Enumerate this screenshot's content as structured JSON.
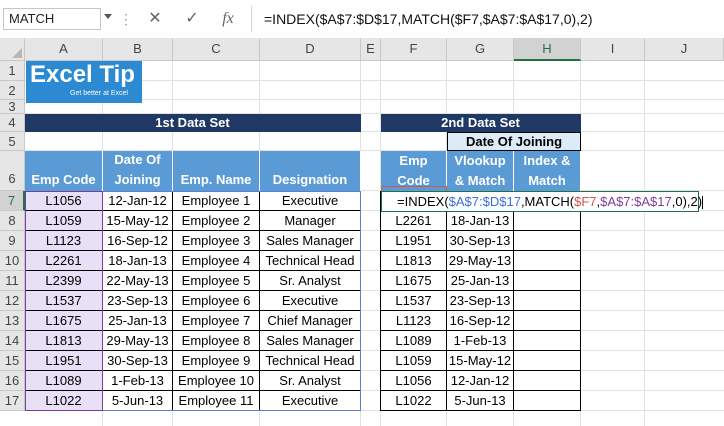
{
  "name_box": "MATCH",
  "formula": "=INDEX($A$7:$D$17,MATCH($F7,$A$7:$A$17,0),2)",
  "formula_buttons": {
    "cancel_glyph": "✕",
    "enter_glyph": "✓",
    "fx_glyph": "fx"
  },
  "columns": [
    "A",
    "B",
    "C",
    "D",
    "E",
    "F",
    "G",
    "H",
    "I",
    "J"
  ],
  "rows": [
    "1",
    "2",
    "3",
    "4",
    "5",
    "6",
    "7",
    "8",
    "9",
    "10",
    "11",
    "12",
    "13",
    "14",
    "15",
    "16",
    "17"
  ],
  "logo": {
    "main": "Excel Tip",
    "tagline": "Get better at Excel"
  },
  "set1": {
    "title": "1st Data Set",
    "headers": [
      "Emp Code",
      "Date Of Joining",
      "Emp. Name",
      "Designation"
    ],
    "rows": [
      [
        "L1056",
        "12-Jan-12",
        "Employee 1",
        "Executive"
      ],
      [
        "L1059",
        "15-May-12",
        "Employee 2",
        "Manager"
      ],
      [
        "L1123",
        "16-Sep-12",
        "Employee 3",
        "Sales Manager"
      ],
      [
        "L2261",
        "18-Jan-13",
        "Employee 4",
        "Technical Head"
      ],
      [
        "L2399",
        "22-May-13",
        "Employee 5",
        "Sr. Analyst"
      ],
      [
        "L1537",
        "23-Sep-13",
        "Employee 6",
        "Executive"
      ],
      [
        "L1675",
        "25-Jan-13",
        "Employee 7",
        "Chief Manager"
      ],
      [
        "L1813",
        "29-May-13",
        "Employee 8",
        "Sales Manager"
      ],
      [
        "L1951",
        "30-Sep-13",
        "Employee 9",
        "Technical Head"
      ],
      [
        "L1089",
        "1-Feb-13",
        "Employee 10",
        "Sr. Analyst"
      ],
      [
        "L1022",
        "5-Jun-13",
        "Employee 11",
        "Executive"
      ]
    ]
  },
  "set2": {
    "title": "2nd Data Set",
    "group_header": "Date Of Joining",
    "headers": [
      "Emp Code",
      "Vlookup & Match",
      "Index & Match"
    ],
    "editing_formula": {
      "p1": "=INDEX(",
      "p2": "$A$7:$D$17",
      "p3": ",MATCH(",
      "p4": "$F7",
      "p5": ",",
      "p6": "$A$7:$A$17",
      "p7": ",0),2)"
    },
    "rows": [
      [
        "L2261",
        "18-Jan-13",
        ""
      ],
      [
        "L1951",
        "30-Sep-13",
        ""
      ],
      [
        "L1813",
        "29-May-13",
        ""
      ],
      [
        "L1675",
        "25-Jan-13",
        ""
      ],
      [
        "L1537",
        "23-Sep-13",
        ""
      ],
      [
        "L1123",
        "16-Sep-12",
        ""
      ],
      [
        "L1089",
        "1-Feb-13",
        ""
      ],
      [
        "L1059",
        "15-May-12",
        ""
      ],
      [
        "L1056",
        "12-Jan-12",
        ""
      ],
      [
        "L1022",
        "5-Jun-13",
        ""
      ]
    ]
  },
  "colors": {
    "navy": "#1f3864",
    "header_blue": "#5b9bd5",
    "light_blue": "#ddebf7",
    "selection_green": "#217346",
    "ref_purple": "#7d3c98",
    "ref_blue": "#3b6fd8",
    "ref_red": "#d9534f"
  }
}
